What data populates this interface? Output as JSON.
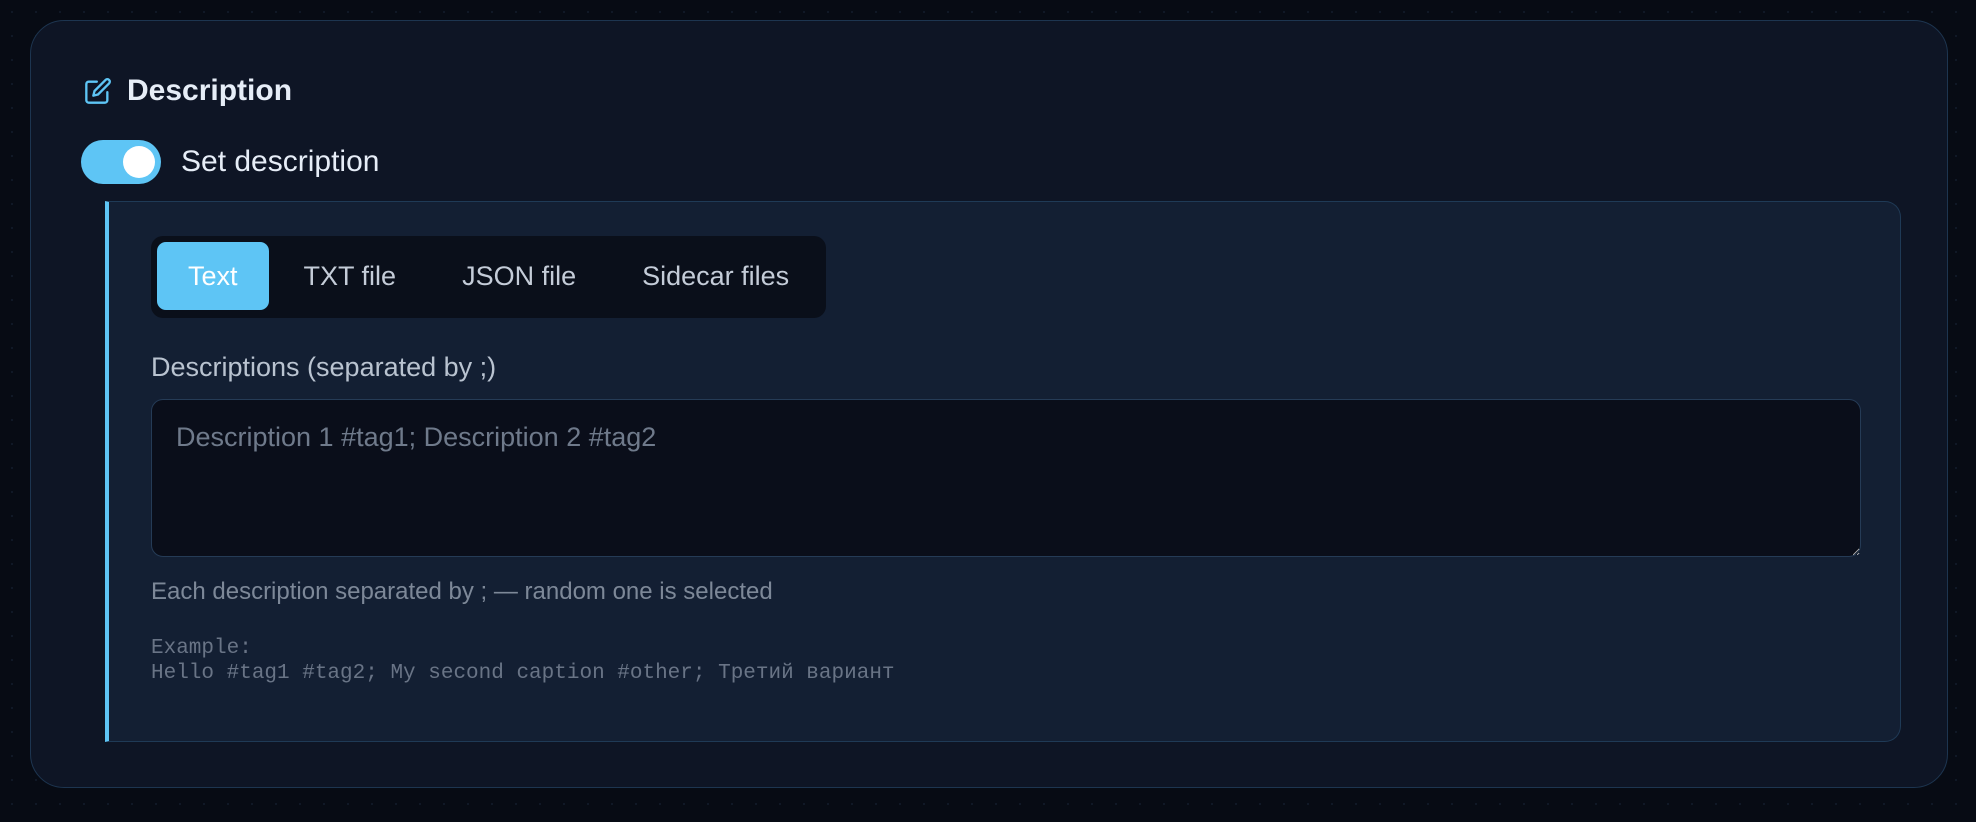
{
  "card": {
    "title": "Description",
    "icon": "edit-icon"
  },
  "toggle": {
    "label": "Set description",
    "on": true
  },
  "tabs": [
    {
      "label": "Text",
      "active": true
    },
    {
      "label": "TXT file",
      "active": false
    },
    {
      "label": "JSON file",
      "active": false
    },
    {
      "label": "Sidecar files",
      "active": false
    }
  ],
  "field": {
    "label": "Descriptions (separated by ;)",
    "placeholder": "Description 1 #tag1; Description 2 #tag2",
    "value": ""
  },
  "help": "Each description separated by ; — random one is selected",
  "example": {
    "heading": "Example:",
    "text": "Hello #tag1 #tag2; My second caption #other; Третий вариант"
  },
  "colors": {
    "accent": "#5ec5f5",
    "background": "#070b14",
    "card": "#0e1525",
    "panel": "#131f33"
  }
}
